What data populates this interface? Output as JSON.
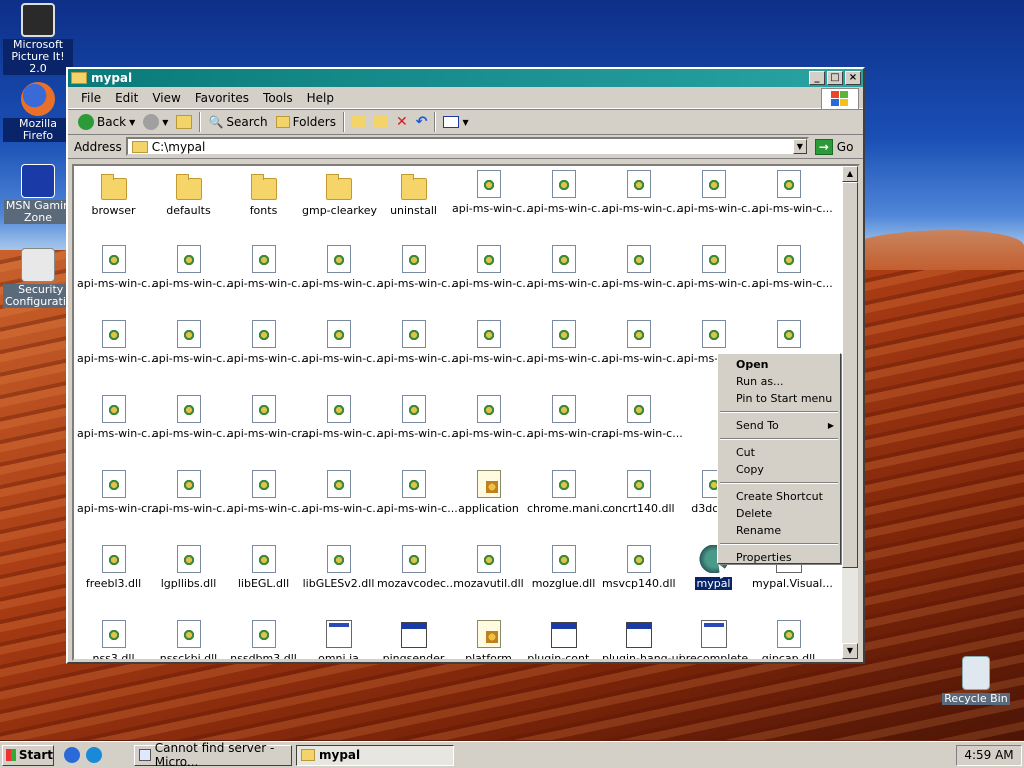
{
  "desktop": {
    "icons": [
      {
        "label_line1": "Microsoft",
        "label_line2": "Picture It! 2.0",
        "icon": "camera-icon"
      },
      {
        "label_line1": "Mozilla Firefo",
        "label_line2": "",
        "icon": "firefox-icon"
      },
      {
        "label_line1": "MSN Gamin",
        "label_line2": "Zone",
        "icon": "msn-zone-icon"
      },
      {
        "label_line1": "Security",
        "label_line2": "Configurati...",
        "icon": "security-config-icon"
      },
      {
        "label_line1": "Recycle Bin",
        "label_line2": "",
        "icon": "recycle-bin-icon"
      }
    ]
  },
  "window": {
    "title": "mypal",
    "menu": [
      "File",
      "Edit",
      "View",
      "Favorites",
      "Tools",
      "Help"
    ],
    "toolbar": {
      "back": "Back",
      "search": "Search",
      "folders": "Folders"
    },
    "address": {
      "label": "Address",
      "value": "C:\\mypal",
      "go": "Go"
    }
  },
  "files": [
    {
      "name": "browser",
      "type": "folder"
    },
    {
      "name": "defaults",
      "type": "folder"
    },
    {
      "name": "fonts",
      "type": "folder"
    },
    {
      "name": "gmp-clearkey",
      "type": "folder"
    },
    {
      "name": "uninstall",
      "type": "folder"
    },
    {
      "name": "api-ms-win-c...",
      "type": "dll"
    },
    {
      "name": "api-ms-win-c...",
      "type": "dll"
    },
    {
      "name": "api-ms-win-c...",
      "type": "dll"
    },
    {
      "name": "api-ms-win-c...",
      "type": "dll"
    },
    {
      "name": "api-ms-win-c...",
      "type": "dll"
    },
    {
      "name": "api-ms-win-c...",
      "type": "dll"
    },
    {
      "name": "api-ms-win-c...",
      "type": "dll"
    },
    {
      "name": "api-ms-win-c...",
      "type": "dll"
    },
    {
      "name": "api-ms-win-c...",
      "type": "dll"
    },
    {
      "name": "api-ms-win-c...",
      "type": "dll"
    },
    {
      "name": "api-ms-win-c...",
      "type": "dll"
    },
    {
      "name": "api-ms-win-c...",
      "type": "dll"
    },
    {
      "name": "api-ms-win-c...",
      "type": "dll"
    },
    {
      "name": "api-ms-win-c...",
      "type": "dll"
    },
    {
      "name": "api-ms-win-c...",
      "type": "dll"
    },
    {
      "name": "api-ms-win-c...",
      "type": "dll"
    },
    {
      "name": "api-ms-win-c...",
      "type": "dll"
    },
    {
      "name": "api-ms-win-c...",
      "type": "dll"
    },
    {
      "name": "api-ms-win-c...",
      "type": "dll"
    },
    {
      "name": "api-ms-win-c...",
      "type": "dll"
    },
    {
      "name": "api-ms-win-c...",
      "type": "dll"
    },
    {
      "name": "api-ms-win-c...",
      "type": "dll"
    },
    {
      "name": "api-ms-win-c...",
      "type": "dll"
    },
    {
      "name": "api-ms-win-c...",
      "type": "dll"
    },
    {
      "name": "",
      "type": "dll"
    },
    {
      "name": "api-ms-win-c...",
      "type": "dll"
    },
    {
      "name": "api-ms-win-c...",
      "type": "dll"
    },
    {
      "name": "api-ms-win-cr...",
      "type": "dll"
    },
    {
      "name": "api-ms-win-c...",
      "type": "dll"
    },
    {
      "name": "api-ms-win-c...",
      "type": "dll"
    },
    {
      "name": "api-ms-win-c...",
      "type": "dll"
    },
    {
      "name": "api-ms-win-cr...",
      "type": "dll"
    },
    {
      "name": "api-ms-win-c...",
      "type": "dll"
    },
    {
      "name": "api-ms-win-cr...",
      "type": "dll"
    },
    {
      "name": "api-ms-win-c...",
      "type": "dll"
    },
    {
      "name": "api-ms-win-c...",
      "type": "dll"
    },
    {
      "name": "api-ms-win-c...",
      "type": "dll"
    },
    {
      "name": "api-ms-win-c...",
      "type": "dll"
    },
    {
      "name": "application",
      "type": "cfg"
    },
    {
      "name": "chrome.mani...",
      "type": "dll"
    },
    {
      "name": "concrt140.dll",
      "type": "dll"
    },
    {
      "name": "d3dcom",
      "type": "dll"
    },
    {
      "name": "freebl3.dll",
      "type": "dll"
    },
    {
      "name": "lgpllibs.dll",
      "type": "dll"
    },
    {
      "name": "libEGL.dll",
      "type": "dll"
    },
    {
      "name": "libGLESv2.dll",
      "type": "dll"
    },
    {
      "name": "mozavcodec...",
      "type": "dll"
    },
    {
      "name": "mozavutil.dll",
      "type": "dll"
    },
    {
      "name": "mozglue.dll",
      "type": "dll"
    },
    {
      "name": "msvcp140.dll",
      "type": "dll"
    },
    {
      "name": "mypal",
      "type": "turtle",
      "selected": true
    },
    {
      "name": "mypal.Visual...",
      "type": "ini"
    },
    {
      "name": "nss3.dll",
      "type": "dll"
    },
    {
      "name": "nssckbi.dll",
      "type": "dll"
    },
    {
      "name": "nssdbm3.dll",
      "type": "dll"
    },
    {
      "name": "omni.ja",
      "type": "ini"
    },
    {
      "name": "pingsender",
      "type": "app"
    },
    {
      "name": "platform",
      "type": "cfg"
    },
    {
      "name": "plugin-cont...",
      "type": "app"
    },
    {
      "name": "plugin-hang-ui",
      "type": "app"
    },
    {
      "name": "precomplete",
      "type": "ini"
    },
    {
      "name": "qipcap.dll",
      "type": "dll"
    }
  ],
  "context_menu": {
    "items": [
      "Open",
      "Run as...",
      "Pin to Start menu",
      "Send To",
      "Cut",
      "Copy",
      "Create Shortcut",
      "Delete",
      "Rename",
      "Properties"
    ]
  },
  "taskbar": {
    "start": "Start",
    "tasks": [
      "Cannot find server - Micro...",
      "mypal"
    ],
    "clock": "4:59 AM"
  }
}
